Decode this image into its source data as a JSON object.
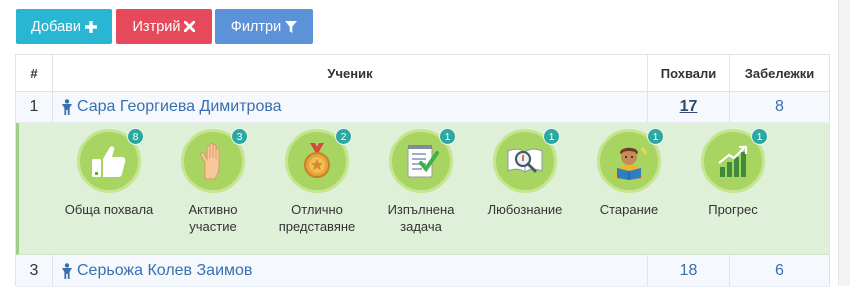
{
  "toolbar": {
    "add_label": "Добави",
    "delete_label": "Изтрий",
    "filter_label": "Филтри"
  },
  "table": {
    "headers": {
      "number": "#",
      "student": "Ученик",
      "praises": "Похвали",
      "notes": "Забележки"
    },
    "students": [
      {
        "number": "1",
        "name": "Сара Георгиева Димитрова",
        "praises": "17",
        "notes": "8"
      },
      {
        "number": "3",
        "name": "Серьожа Колев Заимов",
        "praises": "18",
        "notes": "6"
      }
    ],
    "badges": [
      {
        "label": "Обща похвала",
        "count": "8",
        "icon": "thumbs-up-icon"
      },
      {
        "label": "Активно участие",
        "count": "3",
        "icon": "raised-hand-icon"
      },
      {
        "label": "Отлично представяне",
        "count": "2",
        "icon": "medal-icon"
      },
      {
        "label": "Изпълнена задача",
        "count": "1",
        "icon": "checked-task-icon"
      },
      {
        "label": "Любознание",
        "count": "1",
        "icon": "magnifier-book-icon"
      },
      {
        "label": "Старание",
        "count": "1",
        "icon": "reading-student-icon"
      },
      {
        "label": "Прогрес",
        "count": "1",
        "icon": "growth-chart-icon"
      }
    ]
  },
  "colors": {
    "add": "#29b6d2",
    "delete": "#e6495c",
    "filter": "#5c92d8",
    "badge_green": "#a8d461",
    "badge_count": "#2da8a1",
    "expanded_row": "#dff0d8",
    "link": "#3a6fb0"
  }
}
